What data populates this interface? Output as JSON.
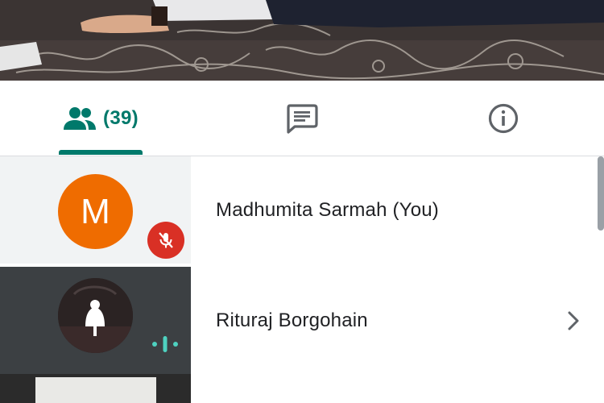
{
  "tabs": {
    "people_count": "(39)",
    "active": "people",
    "people_icon": "people-icon",
    "chat_icon": "chat-icon",
    "info_icon": "info-icon"
  },
  "participants": [
    {
      "initial": "M",
      "name": "Madhumita Sarmah (You)",
      "muted": true,
      "avatar_color": "#ef6c00"
    },
    {
      "name": "Rituraj Borgohain",
      "speaking": true,
      "has_chevron": true
    }
  ],
  "colors": {
    "accent": "#00796b",
    "mute_badge": "#d93025",
    "speaking_indicator": "#4ed2c0"
  }
}
